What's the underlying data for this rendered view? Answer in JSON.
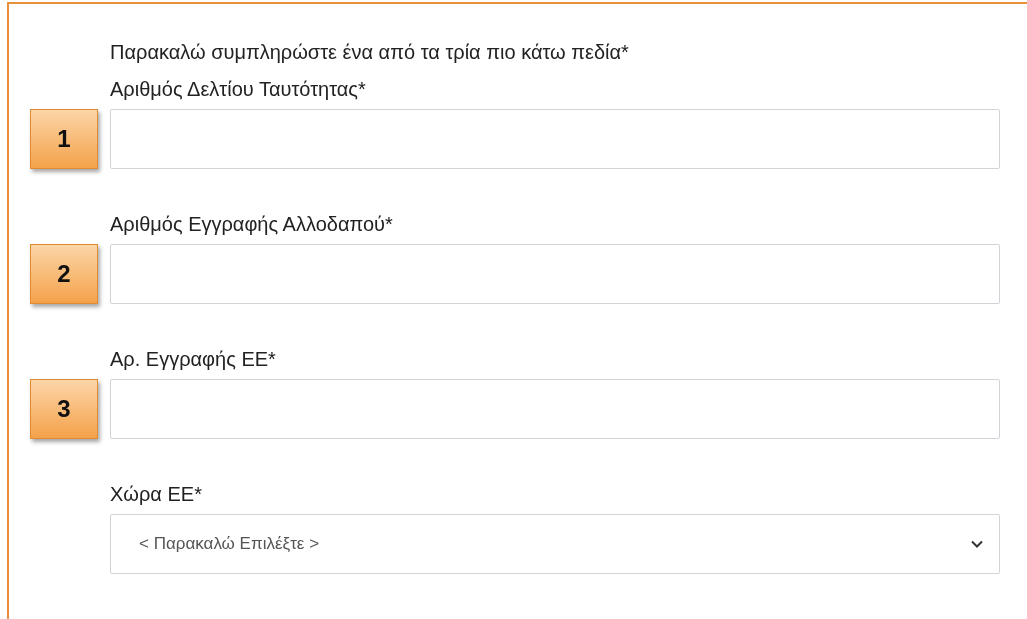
{
  "instruction": "Παρακαλώ συμπληρώστε ένα από τα τρία πιο κάτω πεδία*",
  "fields": [
    {
      "kind": "text",
      "label": "Αριθμός Δελτίου Ταυτότητας*",
      "marker": "1"
    },
    {
      "kind": "text",
      "label": "Αριθμός Εγγραφής Αλλοδαπού*",
      "marker": "2"
    },
    {
      "kind": "text",
      "label": "Αρ. Εγγραφής ΕΕ*",
      "marker": "3"
    },
    {
      "kind": "select",
      "label": "Χώρα ΕΕ*",
      "value": "< Παρακαλώ Επιλέξτε >"
    }
  ]
}
